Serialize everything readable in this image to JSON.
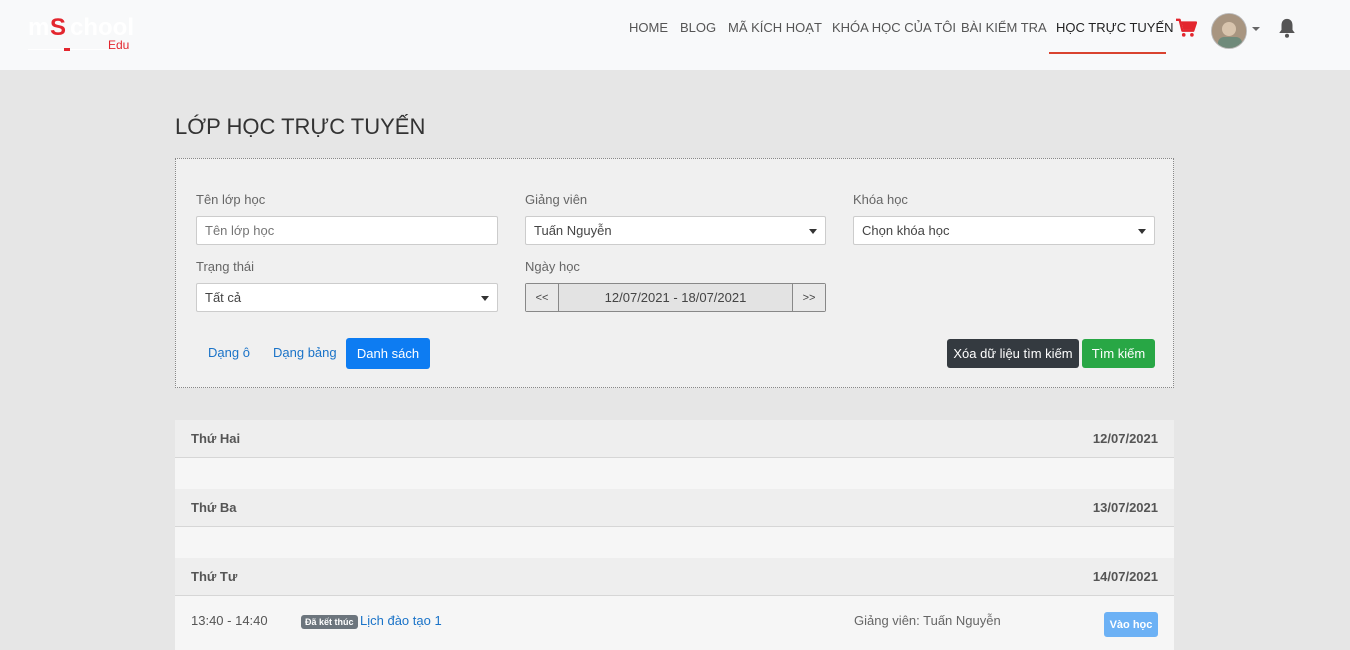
{
  "logo": {
    "m": "m",
    "s": "S",
    "rest": "chool",
    "edu": "Edu"
  },
  "nav": [
    {
      "label": "HOME",
      "active": false
    },
    {
      "label": "BLOG",
      "active": false
    },
    {
      "label": "MÃ KÍCH HOẠT",
      "active": false
    },
    {
      "label": "KHÓA HỌC CỦA TÔI",
      "active": false
    },
    {
      "label": "BÀI KIỂM TRA",
      "active": false
    },
    {
      "label": "HỌC TRỰC TUYẾN",
      "active": true
    }
  ],
  "page_title": "LỚP HỌC TRỰC TUYẾN",
  "filters": {
    "class_name": {
      "label": "Tên lớp học",
      "placeholder": "Tên lớp học",
      "value": ""
    },
    "teacher": {
      "label": "Giảng viên",
      "value": "Tuấn Nguyễn"
    },
    "course": {
      "label": "Khóa học",
      "value": "Chọn khóa học"
    },
    "status": {
      "label": "Trạng thái",
      "value": "Tất cả"
    },
    "date": {
      "label": "Ngày học",
      "prev": "<<",
      "range": "12/07/2021 - 18/07/2021",
      "next": ">>"
    }
  },
  "views": {
    "grid": "Dạng ô",
    "table": "Dạng bảng",
    "list": "Danh sách"
  },
  "actions": {
    "clear": "Xóa dữ liệu tìm kiếm",
    "search": "Tìm kiếm"
  },
  "schedule": {
    "days": [
      {
        "name": "Thứ Hai",
        "date": "12/07/2021"
      },
      {
        "name": "Thứ Ba",
        "date": "13/07/2021"
      },
      {
        "name": "Thứ Tư",
        "date": "14/07/2021"
      }
    ],
    "session": {
      "time": "13:40 - 14:40",
      "badge": "Đã kết thúc",
      "title": "Lịch đào tạo 1",
      "teacher": "Giảng viên: Tuấn Nguyễn",
      "join": "Vào học"
    }
  },
  "colors": {
    "accent": "#d9432f",
    "primary": "#0d7cf2",
    "success": "#28a745",
    "dark": "#343a40",
    "cart": "#e3262e"
  }
}
